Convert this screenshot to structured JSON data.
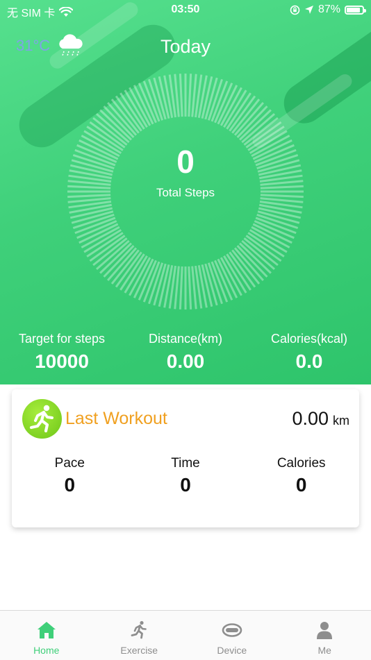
{
  "status_bar": {
    "carrier": "无 SIM 卡",
    "time": "03:50",
    "battery": "87%",
    "battery_level": 0.87
  },
  "weather": {
    "temperature": "31°C",
    "icon": "rain-cloud-icon"
  },
  "hero": {
    "title": "Today",
    "steps_value": "0",
    "steps_label": "Total Steps"
  },
  "stats": [
    {
      "label": "Target for steps",
      "value": "10000"
    },
    {
      "label": "Distance(km)",
      "value": "0.00"
    },
    {
      "label": "Calories(kcal)",
      "value": "0.0"
    }
  ],
  "last_workout": {
    "title": "Last Workout",
    "distance": "0.00",
    "unit": "km",
    "icon": "running-icon",
    "metrics": [
      {
        "label": "Pace",
        "value": "0"
      },
      {
        "label": "Time",
        "value": "0"
      },
      {
        "label": "Calories",
        "value": "0"
      }
    ]
  },
  "tabs": [
    {
      "label": "Home",
      "icon": "home-icon",
      "active": true
    },
    {
      "label": "Exercise",
      "icon": "running-icon",
      "active": false
    },
    {
      "label": "Device",
      "icon": "band-icon",
      "active": false
    },
    {
      "label": "Me",
      "icon": "person-icon",
      "active": false
    }
  ],
  "colors": {
    "accent_green": "#3fcf79",
    "workout_orange": "#f0a020",
    "temperature_blue": "#7fa3e6",
    "tab_inactive": "#8e8e8e"
  }
}
